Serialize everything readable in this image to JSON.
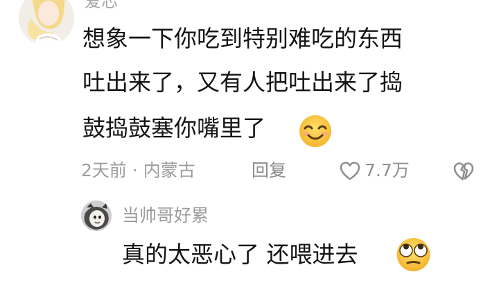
{
  "comment": {
    "author": "爱芯",
    "lines": [
      "想象一下你吃到特别难吃的东西",
      "吐出来了，又有人把吐出来了捣",
      "鼓捣鼓塞你嘴里了"
    ],
    "emoji": "smiling-face-icon",
    "time_location": "2天前 · 内蒙古",
    "reply_label": "回复",
    "like_count": "7.7万"
  },
  "reply": {
    "author": "当帅哥好累",
    "text": "真的太恶心了 还喂进去",
    "emoji": "rolling-eyes-face-icon"
  },
  "colors": {
    "text": "#141414",
    "meta": "#9d9d9d",
    "emoji_yellow": "#ffcc33"
  }
}
